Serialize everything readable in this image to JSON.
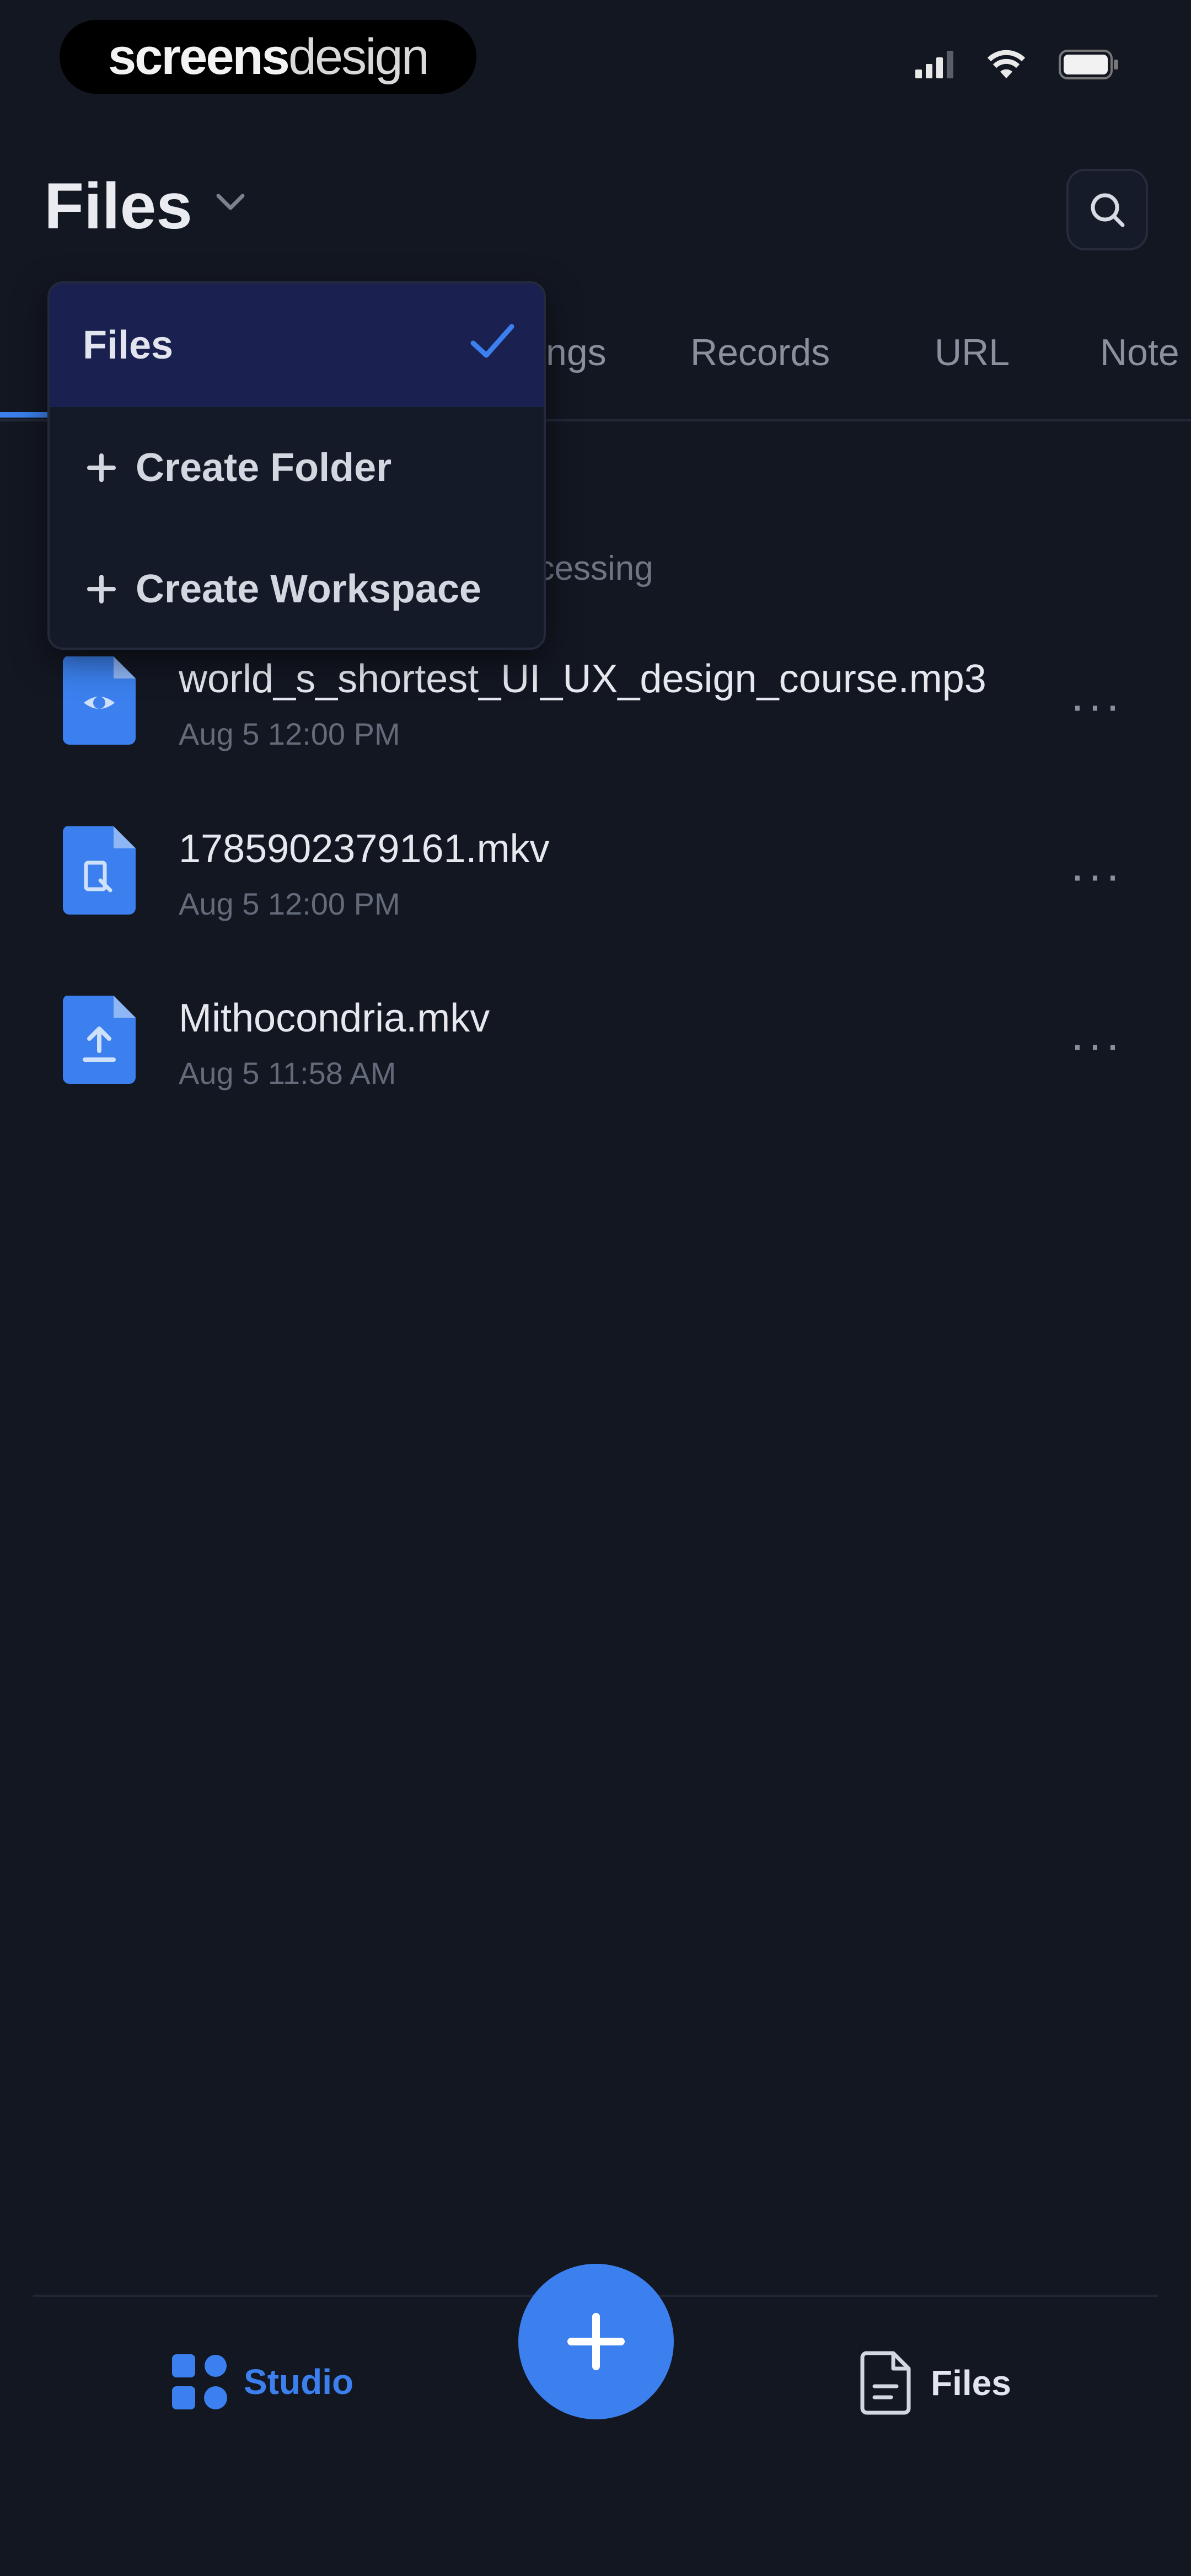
{
  "status_bar": {
    "brand_bold": "screens",
    "brand_light": "design",
    "icons": [
      "cellular-signal-icon",
      "wifi-icon",
      "battery-icon"
    ]
  },
  "header": {
    "title": "Files",
    "icons": [
      "chevron-down-icon",
      "search-icon"
    ]
  },
  "tabs": [
    "Recordings",
    "Records",
    "URL",
    "Notes"
  ],
  "visible_tab_fragments": [
    "ngs",
    "Records",
    "URL",
    "Note"
  ],
  "processing_fragment": "ocessing",
  "dropdown": {
    "selected": "Files",
    "items": [
      "Create Folder",
      "Create Workspace"
    ]
  },
  "files": [
    {
      "name": "world_s_shortest_UI_UX_design_course.mp3",
      "meta": "Aug 5 12:00 PM",
      "icon": "audio-file-icon"
    },
    {
      "name": "1785902379161.mkv",
      "meta": "Aug 5 12:00 PM",
      "icon": "video-file-icon"
    },
    {
      "name": "Mithocondria.mkv",
      "meta": "Aug 5 11:58 AM",
      "icon": "upload-file-icon"
    }
  ],
  "bottom_nav": {
    "studio_label": "Studio",
    "files_label": "Files",
    "fab_icon": "plus-icon"
  },
  "colors": {
    "background": "#131722",
    "accent": "#3b80ee",
    "dropdown_selected": "#1a2050",
    "muted_text": "#636a79"
  }
}
